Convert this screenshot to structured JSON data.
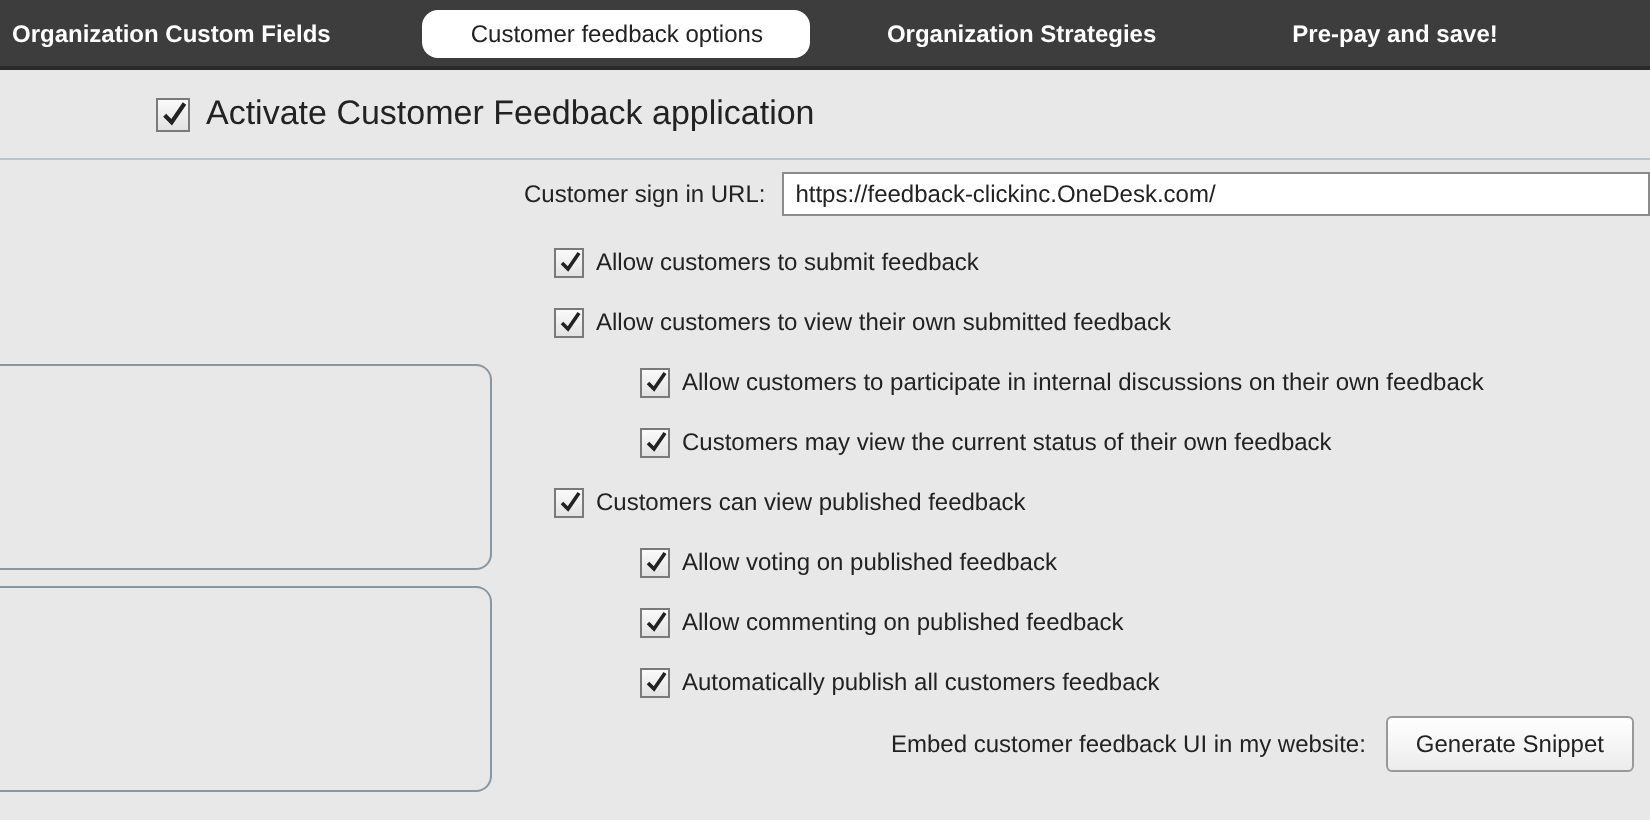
{
  "tabs": [
    {
      "label": "Organization Custom Fields",
      "selected": false
    },
    {
      "label": "Customer feedback options",
      "selected": true
    },
    {
      "label": "Organization Strategies",
      "selected": false
    },
    {
      "label": "Pre-pay and save!",
      "selected": false
    }
  ],
  "activate": {
    "label": "Activate Customer Feedback application",
    "checked": true
  },
  "sign_in_url": {
    "label": "Customer sign in URL:",
    "value": "https://feedback-clickinc.OneDesk.com/"
  },
  "options": [
    {
      "label": "Allow customers to submit feedback",
      "checked": true
    },
    {
      "label": "Allow customers to view their own submitted feedback",
      "checked": true,
      "children": [
        {
          "label": "Allow customers to participate in internal discussions on their own feedback",
          "checked": true
        },
        {
          "label": "Customers may view the current status of their own feedback",
          "checked": true
        }
      ]
    },
    {
      "label": "Customers can view published feedback",
      "checked": true,
      "children": [
        {
          "label": "Allow voting on published feedback",
          "checked": true
        },
        {
          "label": "Allow commenting on published feedback",
          "checked": true
        },
        {
          "label": "Automatically publish all customers feedback",
          "checked": true
        }
      ]
    }
  ],
  "embed": {
    "label": "Embed customer feedback UI in my website:",
    "button": "Generate Snippet"
  }
}
